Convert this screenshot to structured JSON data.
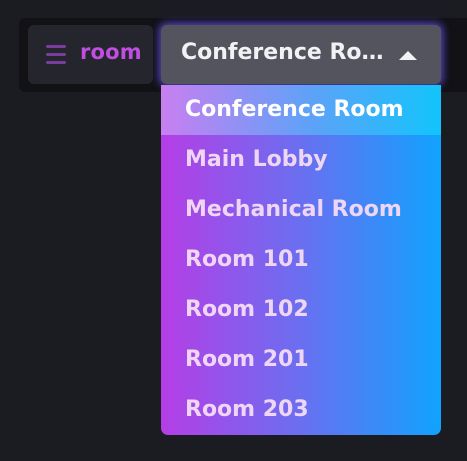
{
  "filter": {
    "label": "room",
    "icon": "menu-icon"
  },
  "select": {
    "value": "Conference Room",
    "icon": "caret-up-icon",
    "open": true
  },
  "options": [
    {
      "label": "Conference Room",
      "selected": true
    },
    {
      "label": "Main Lobby",
      "selected": false
    },
    {
      "label": "Mechanical Room",
      "selected": false
    },
    {
      "label": "Room 101",
      "selected": false
    },
    {
      "label": "Room 102",
      "selected": false
    },
    {
      "label": "Room 201",
      "selected": false
    },
    {
      "label": "Room 203",
      "selected": false
    }
  ],
  "colors": {
    "accent": "#c04ee3",
    "glow": "#6e5aff",
    "gradient_start": "#b53ee6",
    "gradient_end": "#10a3ff"
  }
}
